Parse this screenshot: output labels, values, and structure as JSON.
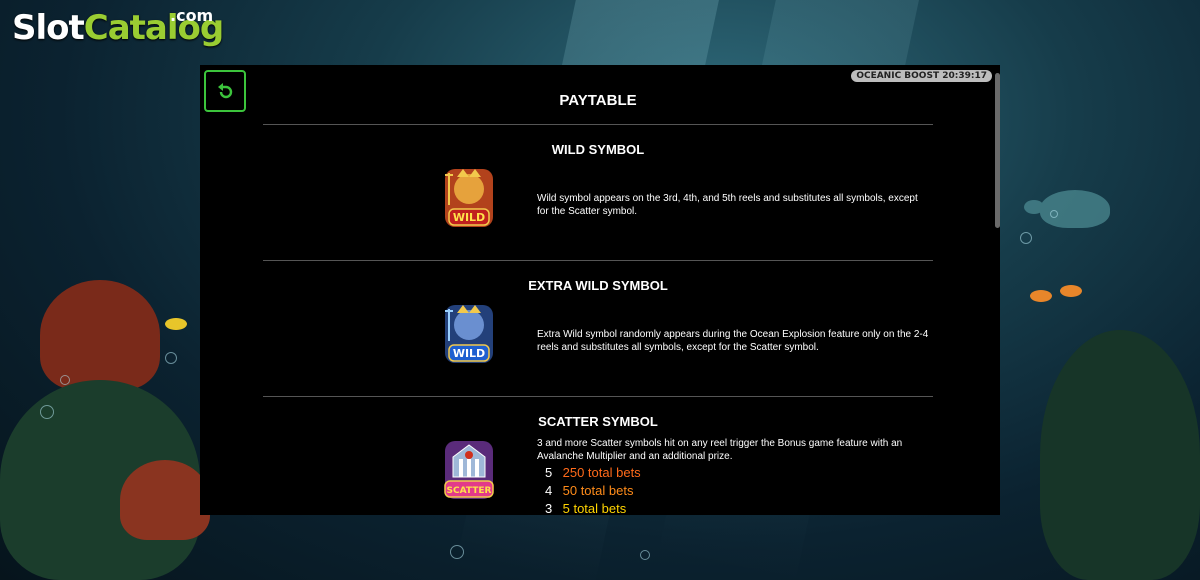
{
  "logo": {
    "slot": "Slot",
    "catalog": "Catalog",
    "dotcom": ".com"
  },
  "panel": {
    "title": "PAYTABLE",
    "timer_badge": "OCEANIC BOOST 20:39:17",
    "back_button": "return-arrow-icon"
  },
  "sections": {
    "wild": {
      "title": "WILD SYMBOL",
      "symbol_label": "WILD",
      "description": "Wild symbol appears on the 3rd, 4th, and 5th reels and substitutes all symbols, except for the Scatter symbol."
    },
    "extra_wild": {
      "title": "EXTRA WILD SYMBOL",
      "symbol_label": "WILD",
      "description": "Extra Wild symbol randomly appears during the Ocean Explosion feature only on the 2-4 reels and substitutes all symbols, except for the Scatter symbol."
    },
    "scatter": {
      "title": "SCATTER SYMBOL",
      "symbol_label": "SCATTER",
      "description": "3 and more Scatter symbols hit on any reel trigger the Bonus game feature with an Avalanche Multiplier and an additional prize.",
      "payouts": [
        {
          "count": "5",
          "value": "250 total bets",
          "color": "#ff6a1a"
        },
        {
          "count": "4",
          "value": "50 total bets",
          "color": "#ff8c1a"
        },
        {
          "count": "3",
          "value": "5 total bets",
          "color": "#ffd400"
        }
      ]
    }
  },
  "colors": {
    "accent_green": "#3cc43c",
    "logo_green": "#9acd32"
  }
}
